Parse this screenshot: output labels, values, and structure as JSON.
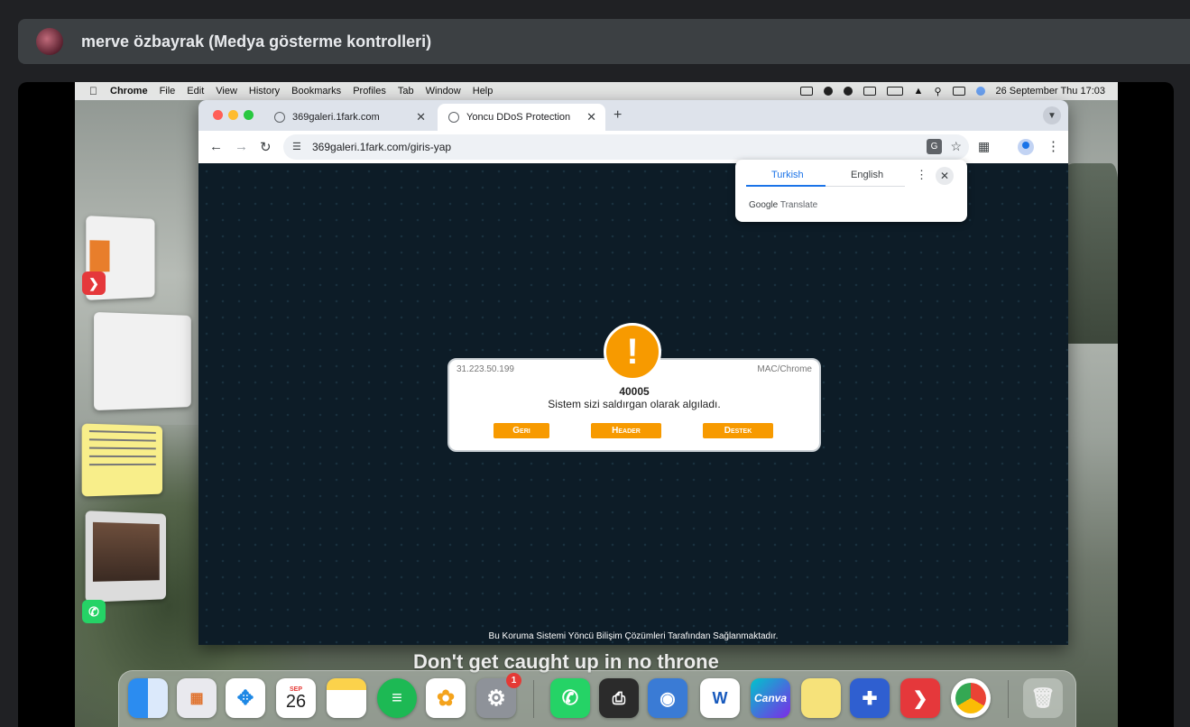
{
  "meet": {
    "presenter_title": "merve özbayrak (Medya gösterme kontrolleri)"
  },
  "menubar": {
    "app": "Chrome",
    "items": [
      "File",
      "Edit",
      "View",
      "History",
      "Bookmarks",
      "Profiles",
      "Tab",
      "Window",
      "Help"
    ],
    "datetime": "26 September Thu  17:03"
  },
  "browser": {
    "tabs": [
      {
        "title": "369galeri.1fark.com"
      },
      {
        "title": "Yoncu DDoS Protection"
      }
    ],
    "new_tab": "+",
    "url": "369galeri.1fark.com/giris-yap"
  },
  "translate": {
    "lang_source": "Turkish",
    "lang_target": "English",
    "brand": "Google",
    "product": "Translate"
  },
  "page": {
    "ip": "31.223.50.199",
    "client": "MAC/Chrome",
    "code": "40005",
    "message": "Sistem sizi saldırgan olarak algıladı.",
    "buttons": [
      "Geri",
      "Header",
      "Destek"
    ],
    "footer": "Bu Koruma Sistemi Yöncü Bilişim Çözümleri Tarafından Sağlanmaktadır."
  },
  "wallpaper": {
    "caption": "Don't get caught up in no throne"
  },
  "dock": {
    "calendar_month": "SEP",
    "calendar_day": "26",
    "settings_badge": "1",
    "canva_label": "Canva",
    "word_label": "W"
  }
}
